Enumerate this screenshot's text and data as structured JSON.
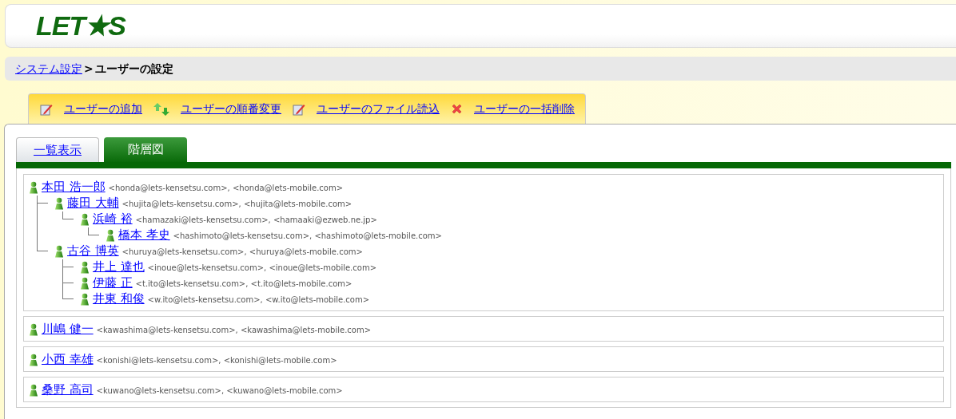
{
  "logo": "LET★S",
  "breadcrumb": {
    "link": "システム設定",
    "separator": ">",
    "current": "ユーザーの設定"
  },
  "actions": [
    {
      "kind": "edit",
      "label": "ユーザーの追加"
    },
    {
      "kind": "reorder",
      "label": "ユーザーの順番変更"
    },
    {
      "kind": "edit",
      "label": "ユーザーのファイル読込"
    },
    {
      "kind": "delete",
      "label": "ユーザーの一括削除"
    }
  ],
  "tabs": [
    {
      "label": "一覧表示",
      "selected": false
    },
    {
      "label": "階層図",
      "selected": true
    }
  ],
  "groups": [
    {
      "name": "本田 浩一郎",
      "emails": "<honda@lets-kensetsu.com>, <honda@lets-mobile.com>",
      "children": [
        {
          "name": "藤田 大輔",
          "emails": "<hujita@lets-kensetsu.com>, <hujita@lets-mobile.com>",
          "children": [
            {
              "name": "浜崎 裕",
              "emails": "<hamazaki@lets-kensetsu.com>, <hamaaki@ezweb.ne.jp>",
              "children": [
                {
                  "name": "橋本 孝史",
                  "emails": "<hashimoto@lets-kensetsu.com>, <hashimoto@lets-mobile.com>"
                }
              ]
            }
          ]
        },
        {
          "name": "古谷 博英",
          "emails": "<huruya@lets-kensetsu.com>, <huruya@lets-mobile.com>",
          "children": [
            {
              "name": "井上 達也",
              "emails": "<inoue@lets-kensetsu.com>, <inoue@lets-mobile.com>"
            },
            {
              "name": "伊藤 正",
              "emails": "<t.ito@lets-kensetsu.com>, <t.ito@lets-mobile.com>"
            },
            {
              "name": "井東 和俊",
              "emails": "<w.ito@lets-kensetsu.com>, <w.ito@lets-mobile.com>"
            }
          ]
        }
      ]
    },
    {
      "name": "川嶋 健一",
      "emails": "<kawashima@lets-kensetsu.com>, <kawashima@lets-mobile.com>"
    },
    {
      "name": "小西 幸雄",
      "emails": "<konishi@lets-kensetsu.com>, <konishi@lets-mobile.com>"
    },
    {
      "name": "桑野 高司",
      "emails": "<kuwano@lets-kensetsu.com>, <kuwano@lets-mobile.com>"
    }
  ]
}
